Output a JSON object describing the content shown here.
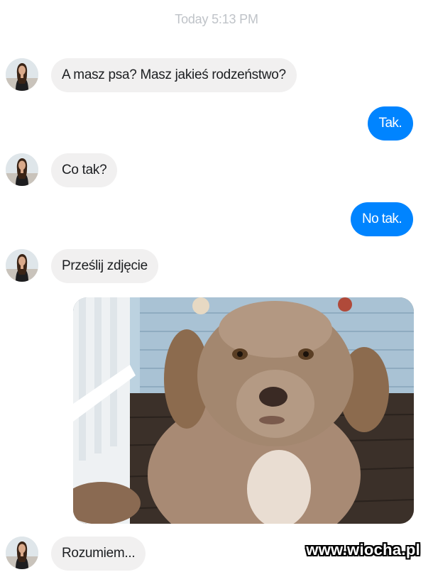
{
  "conversation": {
    "timestamp": "Today 5:13 PM",
    "messages": [
      {
        "from": "them",
        "text": "A masz psa? Masz jakieś rodzeństwo?"
      },
      {
        "from": "me",
        "text": "Tak."
      },
      {
        "from": "them",
        "text": "Co tak?"
      },
      {
        "from": "me",
        "text": "No tak."
      },
      {
        "from": "them",
        "text": "Prześlij zdjęcie"
      },
      {
        "from": "them",
        "type": "image",
        "alt": "dog-photo"
      },
      {
        "from": "them",
        "text": "Rozumiem..."
      }
    ]
  },
  "colors": {
    "outgoing_bubble": "#0084ff",
    "incoming_bubble": "#f1f0f0",
    "timestamp": "#bfc3c8"
  },
  "watermark": "www.wiocha.pl"
}
